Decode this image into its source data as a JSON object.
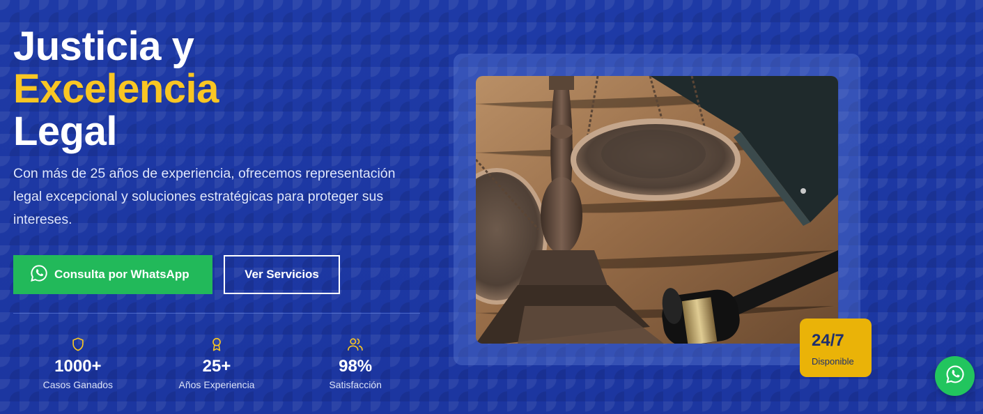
{
  "hero": {
    "title_line1": "Justicia y",
    "title_line2": "Excelencia",
    "title_line3": "Legal",
    "subtitle": "Con más de 25 años de experiencia, ofrecemos representación legal excepcional y soluciones estratégicas para proteger sus intereses.",
    "whatsapp_button": "Consulta por WhatsApp",
    "services_button": "Ver Servicios"
  },
  "stats": [
    {
      "icon": "shield-icon",
      "value": "1000+",
      "label": "Casos Ganados"
    },
    {
      "icon": "award-icon",
      "value": "25+",
      "label": "Años Experiencia"
    },
    {
      "icon": "users-icon",
      "value": "98%",
      "label": "Satisfacción"
    }
  ],
  "badge": {
    "value": "24/7",
    "label": "Disponible"
  },
  "colors": {
    "background": "#1f3aa8",
    "accent_yellow": "#f9c623",
    "whatsapp_green": "#22b95a",
    "badge_yellow": "#eab308"
  }
}
